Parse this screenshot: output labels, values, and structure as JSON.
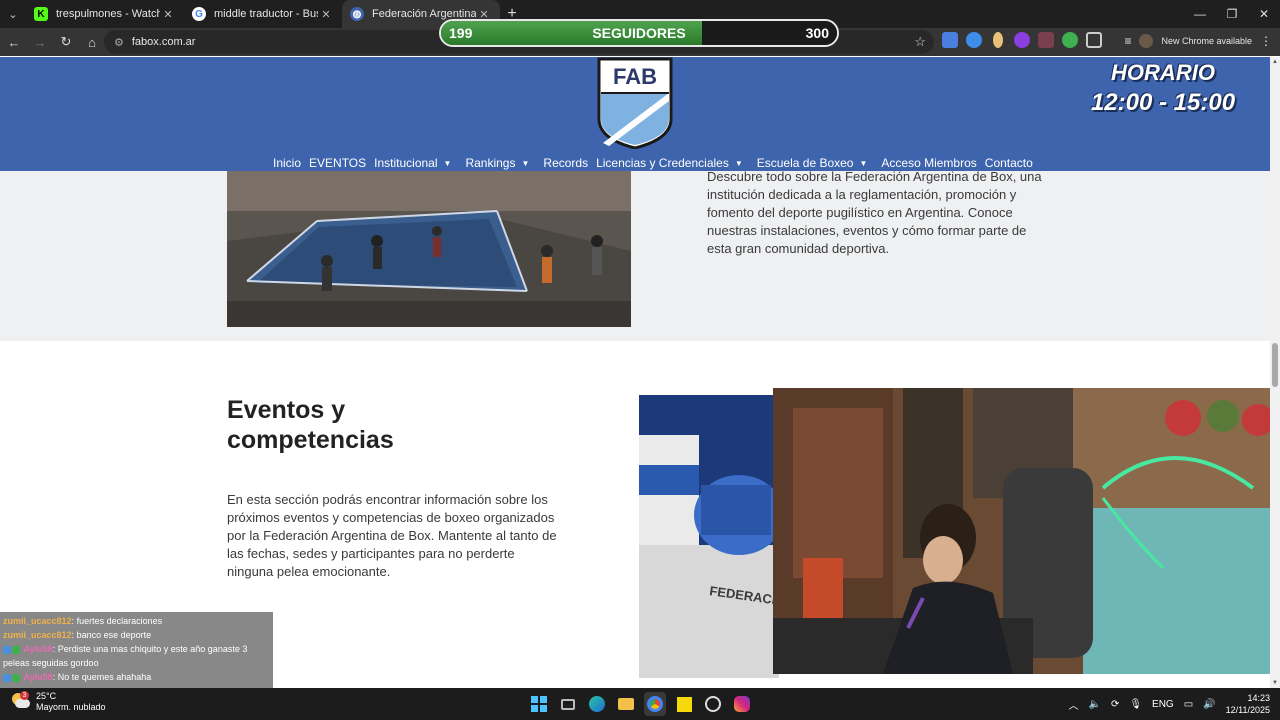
{
  "browser": {
    "tabs": [
      {
        "title": "trespulmones - Watch the VOD",
        "favicon": "kick-icon",
        "color": "#53fc18"
      },
      {
        "title": "middle traductor - Buscar con G",
        "favicon": "google-icon",
        "color": "#ffffff"
      },
      {
        "title": "Federación Argentina de Boxeo",
        "favicon": "globe-icon",
        "color": "#ffffff",
        "active": true
      }
    ],
    "address": "fabox.com.ar",
    "profile_status": "New Chrome available"
  },
  "overlay": {
    "followers_current": "199",
    "followers_label": "SEGUIDORES",
    "followers_goal": "300",
    "progress_fraction": 0.66,
    "bar_color": "#3b8f3b"
  },
  "site": {
    "logo_text": "FAB",
    "horario_label": "HORARIO",
    "horario_time": "12:00 - 15:00",
    "header_color": "#3e64ad",
    "nav": [
      {
        "label": "Inicio",
        "dropdown": false
      },
      {
        "label": "EVENTOS",
        "dropdown": false
      },
      {
        "label": "Institucional",
        "dropdown": true
      },
      {
        "label": "Rankings",
        "dropdown": true
      },
      {
        "label": "Records",
        "dropdown": false
      },
      {
        "label": "Licencias y Credenciales",
        "dropdown": true
      },
      {
        "label": "Escuela de Boxeo",
        "dropdown": true
      },
      {
        "label": "Acceso Miembros",
        "dropdown": false
      },
      {
        "label": "Contacto",
        "dropdown": false
      }
    ],
    "intro_text": "Descubre todo sobre la Federación Argentina de Box, una institución dedicada a la reglamentación, promoción y fomento del deporte pugilístico en Argentina. Conoce nuestras instalaciones, eventos y cómo formar parte de esta gran comunidad deportiva.",
    "events_heading": "Eventos y competencias",
    "events_text": "En esta sección podrás encontrar información sobre los próximos eventos y competencias de boxeo organizados por la Federación Argentina de Box. Mantente al tanto de las fechas, sedes y participantes para no perderte ninguna pelea emocionante.",
    "photo_shirt_text": "FEDERACION ARGENTINA DE BOX"
  },
  "chat": [
    {
      "user": "zumii_ucacc812",
      "text": "fuertes declaraciones",
      "badges": false
    },
    {
      "user": "zumii_ucacc812",
      "text": "banco ese deporte",
      "badges": false
    },
    {
      "user": "Aylu58",
      "text": "Perdiste una mas chiquito y este año ganaste 3 peleas seguidas gordoo",
      "badges": true
    },
    {
      "user": "Aylu58",
      "text": "No te quemes ahahaha",
      "badges": true
    }
  ],
  "taskbar": {
    "temperature": "25°C",
    "weather_desc": "Mayorm. nublado",
    "weather_badge": "3",
    "language": "ENG",
    "time": "14:23",
    "date": "12/11/2025"
  }
}
